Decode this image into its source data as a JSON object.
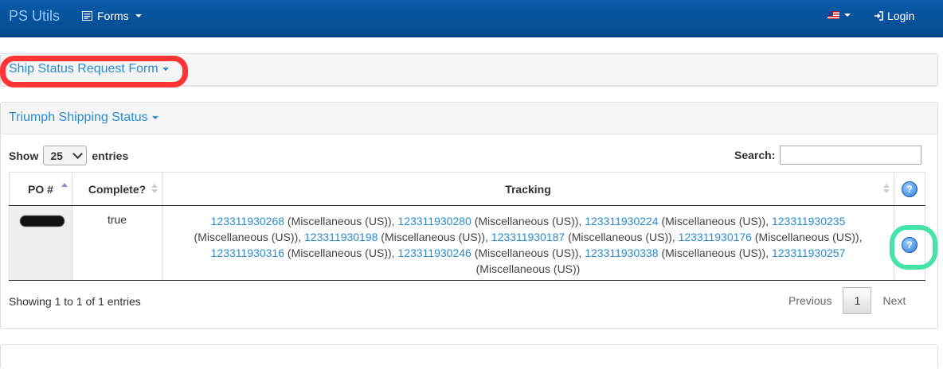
{
  "navbar": {
    "brand": "PS Utils",
    "forms_label": "Forms",
    "login_label": "Login"
  },
  "panels": {
    "ship_status_title": "Ship Status Request Form",
    "triumph_title": "Triumph Shipping Status"
  },
  "table_controls": {
    "show_label": "Show",
    "entries_value": "25",
    "entries_label": "entries",
    "search_label": "Search:",
    "search_value": ""
  },
  "table": {
    "headers": [
      "PO #",
      "Complete?",
      "Tracking"
    ],
    "rows": [
      {
        "complete": "true",
        "tracking": [
          {
            "number": "123311930268",
            "carrier": "(Miscellaneous (US))"
          },
          {
            "number": "123311930280",
            "carrier": "(Miscellaneous (US))"
          },
          {
            "number": "123311930224",
            "carrier": "(Miscellaneous (US))"
          },
          {
            "number": "123311930235",
            "carrier": "(Miscellaneous (US))"
          },
          {
            "number": "123311930198",
            "carrier": "(Miscellaneous (US))"
          },
          {
            "number": "123311930187",
            "carrier": "(Miscellaneous (US))"
          },
          {
            "number": "123311930176",
            "carrier": "(Miscellaneous (US))"
          },
          {
            "number": "123311930316",
            "carrier": "(Miscellaneous (US))"
          },
          {
            "number": "123311930246",
            "carrier": "(Miscellaneous (US))"
          },
          {
            "number": "123311930338",
            "carrier": "(Miscellaneous (US))"
          },
          {
            "number": "123311930257",
            "carrier": "(Miscellaneous (US))"
          }
        ]
      }
    ]
  },
  "footer": {
    "info": "Showing 1 to 1 of 1 entries",
    "previous": "Previous",
    "current_page": "1",
    "next": "Next"
  },
  "icons": {
    "help": "?"
  },
  "colors": {
    "navbar": "#064a8e",
    "link": "#2a8ccf",
    "annotation_red": "#ff2a2a",
    "annotation_green": "#44e3a7"
  }
}
